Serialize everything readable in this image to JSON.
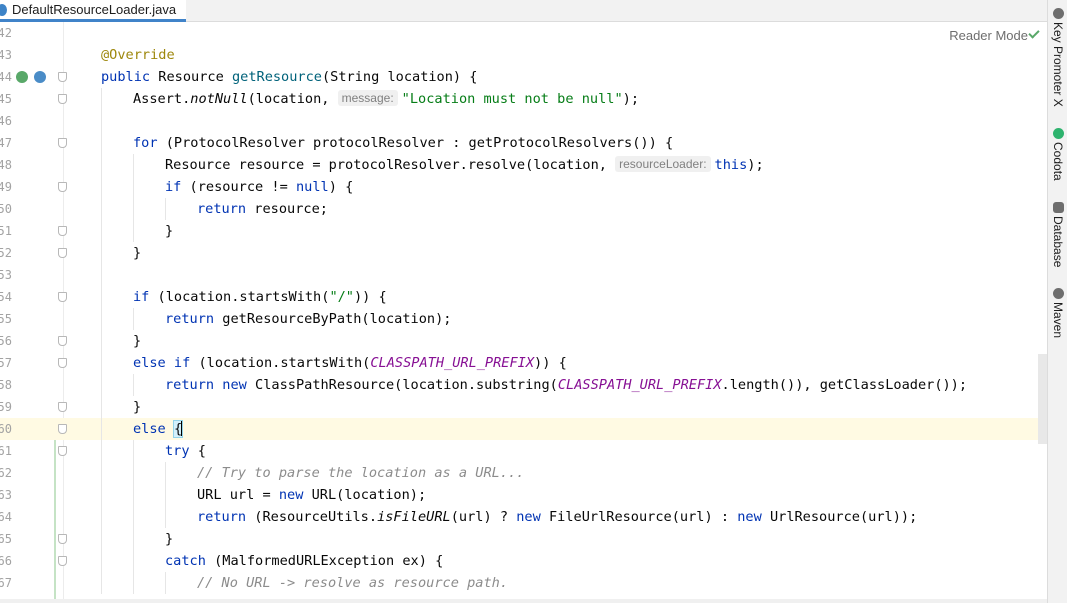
{
  "tab": {
    "title": "DefaultResourceLoader.java",
    "icon": "java-class-icon"
  },
  "editor": {
    "reader_mode_label": "Reader Mode",
    "lines": [
      {
        "ln": "42",
        "indent": 0,
        "html": ""
      },
      {
        "ln": "43",
        "indent": 0,
        "html": "<span class='an'>@Override</span>"
      },
      {
        "ln": "44",
        "indent": 0,
        "html": "<span class='kw'>public</span> Resource <span class='fn'>getResource</span>(String location) {"
      },
      {
        "ln": "45",
        "indent": 1,
        "html": "Assert.<span class='it'>notNull</span>(location, <span class='hint'>message:</span><span class='st'>\"Location must not be null\"</span>);"
      },
      {
        "ln": "46",
        "indent": 1,
        "html": ""
      },
      {
        "ln": "47",
        "indent": 1,
        "html": "<span class='kw'>for</span> (ProtocolResolver protocolResolver : getProtocolResolvers()) {"
      },
      {
        "ln": "48",
        "indent": 2,
        "html": "Resource resource = protocolResolver.resolve(location, <span class='hint'>resourceLoader:</span><span class='kw'>this</span>);"
      },
      {
        "ln": "49",
        "indent": 2,
        "html": "<span class='kw'>if</span> (resource != <span class='kw'>null</span>) {"
      },
      {
        "ln": "50",
        "indent": 3,
        "html": "<span class='kw'>return</span> resource;"
      },
      {
        "ln": "51",
        "indent": 2,
        "html": "}"
      },
      {
        "ln": "52",
        "indent": 1,
        "html": "}"
      },
      {
        "ln": "53",
        "indent": 1,
        "html": ""
      },
      {
        "ln": "54",
        "indent": 1,
        "html": "<span class='kw'>if</span> (location.startsWith(<span class='st'>\"/\"</span>)) {"
      },
      {
        "ln": "55",
        "indent": 2,
        "html": "<span class='kw'>return</span> getResourceByPath(location);"
      },
      {
        "ln": "56",
        "indent": 1,
        "html": "}"
      },
      {
        "ln": "57",
        "indent": 1,
        "html": "<span class='kw'>else if</span> (location.startsWith(<span class='cst'>CLASSPATH_URL_PREFIX</span>)) {"
      },
      {
        "ln": "58",
        "indent": 2,
        "html": "<span class='kw'>return new</span> ClassPathResource(location.substring(<span class='cst'>CLASSPATH_URL_PREFIX</span>.length()), getClassLoader());"
      },
      {
        "ln": "59",
        "indent": 1,
        "html": "}"
      },
      {
        "ln": "60",
        "indent": 1,
        "html": "<span class='kw'>else</span> <span class='brace-hl'>{</span><span class='caret'></span>",
        "current": true
      },
      {
        "ln": "61",
        "indent": 2,
        "html": "<span class='kw'>try</span> {"
      },
      {
        "ln": "62",
        "indent": 3,
        "html": "<span class='cm'>// Try to parse the location as a URL...</span>"
      },
      {
        "ln": "63",
        "indent": 3,
        "html": "URL url = <span class='kw'>new</span> URL(location);"
      },
      {
        "ln": "64",
        "indent": 3,
        "html": "<span class='kw'>return</span> (ResourceUtils.<span class='it'>isFileURL</span>(url) ? <span class='kw'>new</span> FileUrlResource(url) : <span class='kw'>new</span> UrlResource(url));"
      },
      {
        "ln": "65",
        "indent": 2,
        "html": "}"
      },
      {
        "ln": "66",
        "indent": 2,
        "html": "<span class='kw'>catch</span> (MalformedURLException ex) {"
      },
      {
        "ln": "67",
        "indent": 3,
        "html": "<span class='cm'>// No URL -&gt; resolve as resource path.</span>"
      }
    ]
  },
  "tool_windows": [
    {
      "label": "Key Promoter X",
      "icon": "key-promoter-icon"
    },
    {
      "label": "Codota",
      "icon": "codota-icon"
    },
    {
      "label": "Database",
      "icon": "database-icon"
    },
    {
      "label": "Maven",
      "icon": "maven-icon"
    }
  ],
  "colors": {
    "keyword": "#0033b3",
    "annotation": "#9e880d",
    "method": "#00627a",
    "string": "#067d17",
    "comment": "#8c8c8c",
    "constant": "#871094",
    "tab_underline": "#4083c9",
    "current_line": "#fffae3"
  }
}
